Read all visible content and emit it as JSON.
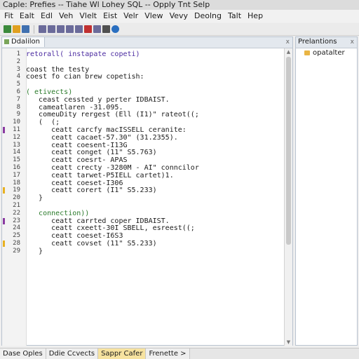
{
  "window": {
    "title": "Caple: Prefies -- Tiahe Wl Lohey SQL -- Opply Tnt Selp"
  },
  "menu": [
    "Fit",
    "Ealt",
    "Edl",
    "Veh",
    "Vlelt",
    "Eist",
    "Velr",
    "Vlew",
    "Vevy",
    "Deolng",
    "Talt",
    "Hep"
  ],
  "toolbar": {
    "icons": [
      "add-icon",
      "folder-icon",
      "save-icon",
      "separator",
      "checkbox-icon",
      "checkbox-icon",
      "checkbox-icon",
      "checkbox-icon",
      "checkbox-icon",
      "stop-icon",
      "checkbox-icon",
      "print-icon",
      "help-icon"
    ],
    "colors": [
      "#3b8a3b",
      "#e0a020",
      "#4070b0",
      "",
      "#6b6b9a",
      "#6b6b9a",
      "#6b6b9a",
      "#6b6b9a",
      "#6b6b9a",
      "#c03030",
      "#6b6b9a",
      "#505050",
      "#2a6fc0"
    ]
  },
  "editor": {
    "tab_label": "Ddalilon",
    "close_label": "x",
    "lines": [
      {
        "num": "1",
        "text": "retorall( instapate copeti)",
        "color": "#4a2aa0",
        "marker": ""
      },
      {
        "num": "2",
        "text": "",
        "color": "#000000",
        "marker": ""
      },
      {
        "num": "3",
        "text": "coast the testy",
        "color": "#1a1a1a",
        "marker": ""
      },
      {
        "num": "4",
        "text": "coest fo cian brew copetish:",
        "color": "#1a1a1a",
        "marker": ""
      },
      {
        "num": "5",
        "text": "",
        "color": "#000000",
        "marker": ""
      },
      {
        "num": "6",
        "text": "( etivects)",
        "color": "#2a7a2a",
        "marker": ""
      },
      {
        "num": "7",
        "text": "   ceast cessted y perter IDBAIST.",
        "color": "#1a1a1a",
        "marker": ""
      },
      {
        "num": "8",
        "text": "   cameatlaren -31.095.",
        "color": "#1a1a1a",
        "marker": ""
      },
      {
        "num": "9",
        "text": "   comeuDity rergest (Ell (I1)\" rateot((;",
        "color": "#1a1a1a",
        "marker": ""
      },
      {
        "num": "10",
        "text": "   (  (;",
        "color": "#1a1a1a",
        "marker": ""
      },
      {
        "num": "11",
        "text": "      ceatt carcfy macISSELL ceranite:",
        "color": "#1a1a1a",
        "marker": "#8a3aa0"
      },
      {
        "num": "12",
        "text": "      ceatt cacaet-57.30\" (31.2355).",
        "color": "#1a1a1a",
        "marker": ""
      },
      {
        "num": "13",
        "text": "      ceatt coesent-I13G",
        "color": "#1a1a1a",
        "marker": ""
      },
      {
        "num": "14",
        "text": "      ceatt conget (11\" S5.763)",
        "color": "#1a1a1a",
        "marker": ""
      },
      {
        "num": "15",
        "text": "      ceatt coesrt- APAS",
        "color": "#1a1a1a",
        "marker": ""
      },
      {
        "num": "16",
        "text": "      ceatt crecty -3280M - AI\" conncilor",
        "color": "#1a1a1a",
        "marker": ""
      },
      {
        "num": "17",
        "text": "      ceatt tarwet-P5IELL cartet)1.",
        "color": "#1a1a1a",
        "marker": ""
      },
      {
        "num": "18",
        "text": "      ceatt coeset-I306",
        "color": "#1a1a1a",
        "marker": ""
      },
      {
        "num": "19",
        "text": "      ceatt corert (I1\" S5.233)",
        "color": "#1a1a1a",
        "marker": "#e8b020"
      },
      {
        "num": "20",
        "text": "   }",
        "color": "#1a1a1a",
        "marker": ""
      },
      {
        "num": "21",
        "text": "",
        "color": "#000000",
        "marker": ""
      },
      {
        "num": "22",
        "text": "   connection))",
        "color": "#2a7a2a",
        "marker": ""
      },
      {
        "num": "23",
        "text": "      ceatt carrted coper IDBAIST.",
        "color": "#1a1a1a",
        "marker": "#8a3aa0"
      },
      {
        "num": "24",
        "text": "      ceatt cxeett-30I SBELL, esreest((;",
        "color": "#1a1a1a",
        "marker": ""
      },
      {
        "num": "25",
        "text": "      ceatt coeset-I6S3",
        "color": "#1a1a1a",
        "marker": ""
      },
      {
        "num": "28",
        "text": "      ceatt covset (11\" S5.233)",
        "color": "#1a1a1a",
        "marker": "#e8b020"
      },
      {
        "num": "29",
        "text": "   }",
        "color": "#1a1a1a",
        "marker": ""
      }
    ]
  },
  "right_panel": {
    "tab_label": "Prelantions",
    "close_label": "x",
    "item_label": "opatalter"
  },
  "bottom_tabs": [
    {
      "label": "Dase Oples",
      "active": false
    },
    {
      "label": "Ddie Ccvects",
      "active": false
    },
    {
      "label": "Sappr Cafer",
      "active": true
    },
    {
      "label": "Frenette >",
      "active": false
    }
  ]
}
